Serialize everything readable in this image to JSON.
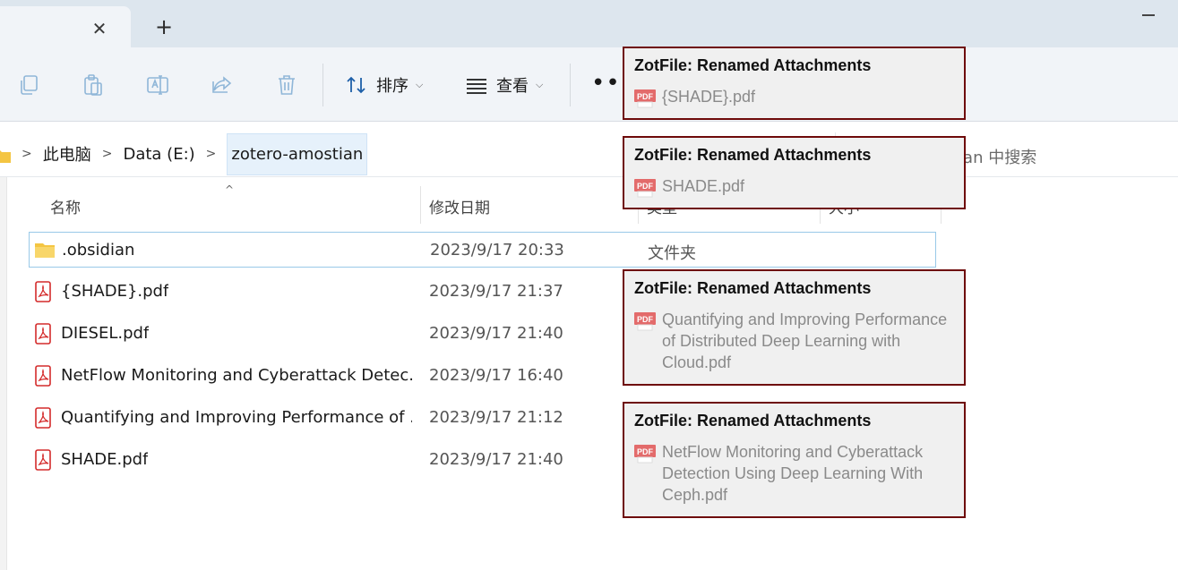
{
  "tabstrip": {
    "close_glyph": "✕",
    "new_tab_glyph": "+"
  },
  "toolbar": {
    "sort_label": "排序",
    "view_label": "查看",
    "more_glyph": "•••",
    "icons": [
      "copy-icon",
      "paste-icon",
      "rename-icon",
      "share-icon",
      "delete-icon",
      "sort-icon",
      "view-icon"
    ]
  },
  "address": {
    "crumbs": [
      "此电脑",
      "Data (E:)",
      "zotero-amostian"
    ],
    "search_placeholder": "tian 中搜索"
  },
  "columns": {
    "name": "名称",
    "modified": "修改日期",
    "type": "类型",
    "size": "大小"
  },
  "files": [
    {
      "name": ".obsidian",
      "modified": "2023/9/17 20:33",
      "type": "文件夹",
      "icon": "folder-icon"
    },
    {
      "name": "{SHADE}.pdf",
      "modified": "2023/9/17 21:37",
      "type": "",
      "icon": "pdf-icon"
    },
    {
      "name": "DIESEL.pdf",
      "modified": "2023/9/17 21:40",
      "type": "",
      "icon": "pdf-icon"
    },
    {
      "name": "NetFlow Monitoring and Cyberattack Detec...",
      "modified": "2023/9/17 16:40",
      "type": "",
      "icon": "pdf-icon"
    },
    {
      "name": "Quantifying and Improving Performance of ...",
      "modified": "2023/9/17 21:12",
      "type": "",
      "icon": "pdf-icon"
    },
    {
      "name": "SHADE.pdf",
      "modified": "2023/9/17 21:40",
      "type": "",
      "icon": "pdf-icon"
    }
  ],
  "popups": [
    {
      "title": "ZotFile: Renamed Attachments",
      "text": "{SHADE}.pdf"
    },
    {
      "title": "ZotFile: Renamed Attachments",
      "text": "SHADE.pdf"
    },
    {
      "title": "ZotFile: Renamed Attachments",
      "text": "Quantifying and Improving Performance of Distributed Deep Learning with Cloud.pdf"
    },
    {
      "title": "ZotFile: Renamed Attachments",
      "text": "NetFlow Monitoring and Cyberattack Detection Using Deep Learning With Ceph.pdf"
    }
  ],
  "colors": {
    "popup_border": "#6e0a0a",
    "popup_bg": "#f0f0f0",
    "selection_border": "#99c9e8",
    "pdf_red": "#d42b2b",
    "folder_yellow": "#f4c542"
  }
}
